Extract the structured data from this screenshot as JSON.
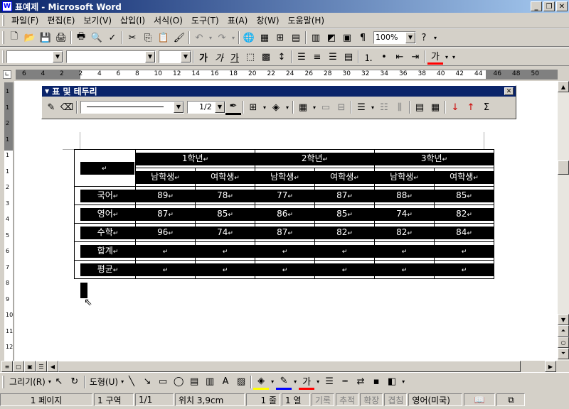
{
  "window": {
    "title": "표예제 - Microsoft Word",
    "icon": "W"
  },
  "menu": [
    "파일(F)",
    "편집(E)",
    "보기(V)",
    "삽입(I)",
    "서식(O)",
    "도구(T)",
    "표(A)",
    "창(W)",
    "도움말(H)"
  ],
  "standard_toolbar": {
    "zoom": "100%"
  },
  "format_toolbar": {
    "style": "",
    "font": "",
    "size": "",
    "bold": "가",
    "italic": "가",
    "underline": "가",
    "font_color": "가"
  },
  "ruler": {
    "ticks": [
      "6",
      "4",
      "2",
      "2",
      "4",
      "6",
      "8",
      "10",
      "12",
      "14",
      "16",
      "18",
      "20",
      "22",
      "24",
      "26",
      "28",
      "30",
      "32",
      "34",
      "36",
      "38",
      "40",
      "42",
      "44",
      "46",
      "48",
      "50"
    ]
  },
  "vruler": {
    "ticks": [
      "1",
      "1",
      "2",
      "1",
      "1",
      "1",
      "2",
      "3",
      "4",
      "5",
      "6",
      "7",
      "8",
      "9",
      "10",
      "11",
      "12"
    ]
  },
  "tables_toolbar": {
    "title": "표 및 테두리",
    "line_weight": "1/2"
  },
  "table": {
    "grades": [
      "1학년",
      "2학년",
      "3학년"
    ],
    "genders": [
      "남학생",
      "여학생",
      "남학생",
      "여학생",
      "남학생",
      "여학생"
    ],
    "rows": [
      {
        "label": "국어",
        "values": [
          "89",
          "78",
          "77",
          "87",
          "88",
          "85"
        ]
      },
      {
        "label": "영어",
        "values": [
          "87",
          "85",
          "86",
          "85",
          "74",
          "82"
        ]
      },
      {
        "label": "수학",
        "values": [
          "96",
          "74",
          "87",
          "82",
          "82",
          "84"
        ]
      },
      {
        "label": "합계",
        "values": [
          "",
          "",
          "",
          "",
          "",
          ""
        ]
      },
      {
        "label": "평균",
        "values": [
          "",
          "",
          "",
          "",
          "",
          ""
        ]
      }
    ],
    "para_mark": "↵"
  },
  "drawing_toolbar": {
    "draw": "그리기(R)",
    "autoshapes": "도형(U)",
    "font_color": "가"
  },
  "status": {
    "page": "1 페이지",
    "section": "1 구역",
    "pages": "1/1",
    "position": "위치 3,9cm",
    "line": "1 줄",
    "col": "1 열",
    "rec": "기록",
    "trk": "추적",
    "ext": "확장",
    "ovr": "겹침",
    "lang": "영어(미국)"
  }
}
